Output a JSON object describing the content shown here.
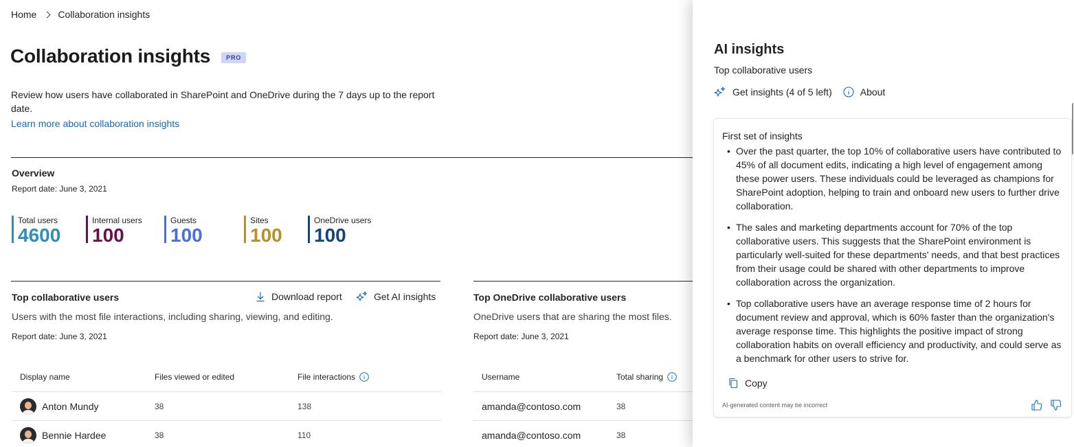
{
  "breadcrumb": {
    "home": "Home",
    "current": "Collaboration insights"
  },
  "page": {
    "title": "Collaboration insights",
    "badge": "PRO",
    "description": "Review how users have collaborated in SharePoint and OneDrive during the 7 days up to the report date.",
    "learn_more": "Learn more about collaboration insights"
  },
  "overview": {
    "title": "Overview",
    "report_date": "Report date: June 3, 2021",
    "stats": [
      {
        "label": "Total users",
        "value": "4600",
        "color": "#2f8fb8"
      },
      {
        "label": "Internal users",
        "value": "100",
        "color": "#6b0f4a"
      },
      {
        "label": "Guests",
        "value": "100",
        "color": "#4a6ee0"
      },
      {
        "label": "Sites",
        "value": "100",
        "color": "#b8902a"
      },
      {
        "label": "OneDrive users",
        "value": "100",
        "color": "#14457a"
      }
    ]
  },
  "top_users": {
    "title": "Top collaborative users",
    "download_label": "Download report",
    "ai_label": "Get AI insights",
    "subtitle": "Users with the most file interactions, including sharing, viewing, and editing.",
    "report_date": "Report date: June 3, 2021",
    "columns": [
      "Display name",
      "Files viewed or edited",
      "File interactions"
    ],
    "rows": [
      {
        "name": "Anton Mundy",
        "files": "38",
        "interactions": "138"
      },
      {
        "name": "Bennie Hardee",
        "files": "38",
        "interactions": "110"
      }
    ]
  },
  "onedrive_users": {
    "title": "Top OneDrive collaborative users",
    "subtitle": "OneDrive users that are sharing the most files.",
    "report_date": "Report date: June 3, 2021",
    "columns": [
      "Username",
      "Total sharing"
    ],
    "rows": [
      {
        "username": "amanda@contoso.com",
        "sharing": "38"
      },
      {
        "username": "amanda@contoso.com",
        "sharing": "38"
      }
    ]
  },
  "ai_panel": {
    "title": "AI insights",
    "subtitle": "Top collaborative users",
    "get_insights": "Get insights (4 of 5 left)",
    "about": "About",
    "card": {
      "title": "First set of insights",
      "bullets": [
        "Over the past quarter, the top 10% of collaborative users have contributed to 45% of all document edits, indicating a high level of engagement among these power users. These individuals could be leveraged as champions for SharePoint adoption, helping to train and onboard new users to further drive collaboration.",
        "The sales and marketing departments account for 70% of the top collaborative users. This suggests that the SharePoint environment is particularly well-suited for these departments' needs, and that best practices from their usage could be shared with other departments to improve collaboration across the organization.",
        "Top collaborative users have an average response time of 2 hours for document review and approval, which is 60% faster than the organization's average response time. This highlights the positive impact of strong collaboration habits on overall efficiency and productivity, and could serve as a benchmark for other users to strive for."
      ],
      "copy": "Copy",
      "disclaimer": "AI-generated content may be incorrect"
    }
  },
  "colors": {
    "link": "#0f6cbd",
    "accent": "#0f6cbd"
  }
}
